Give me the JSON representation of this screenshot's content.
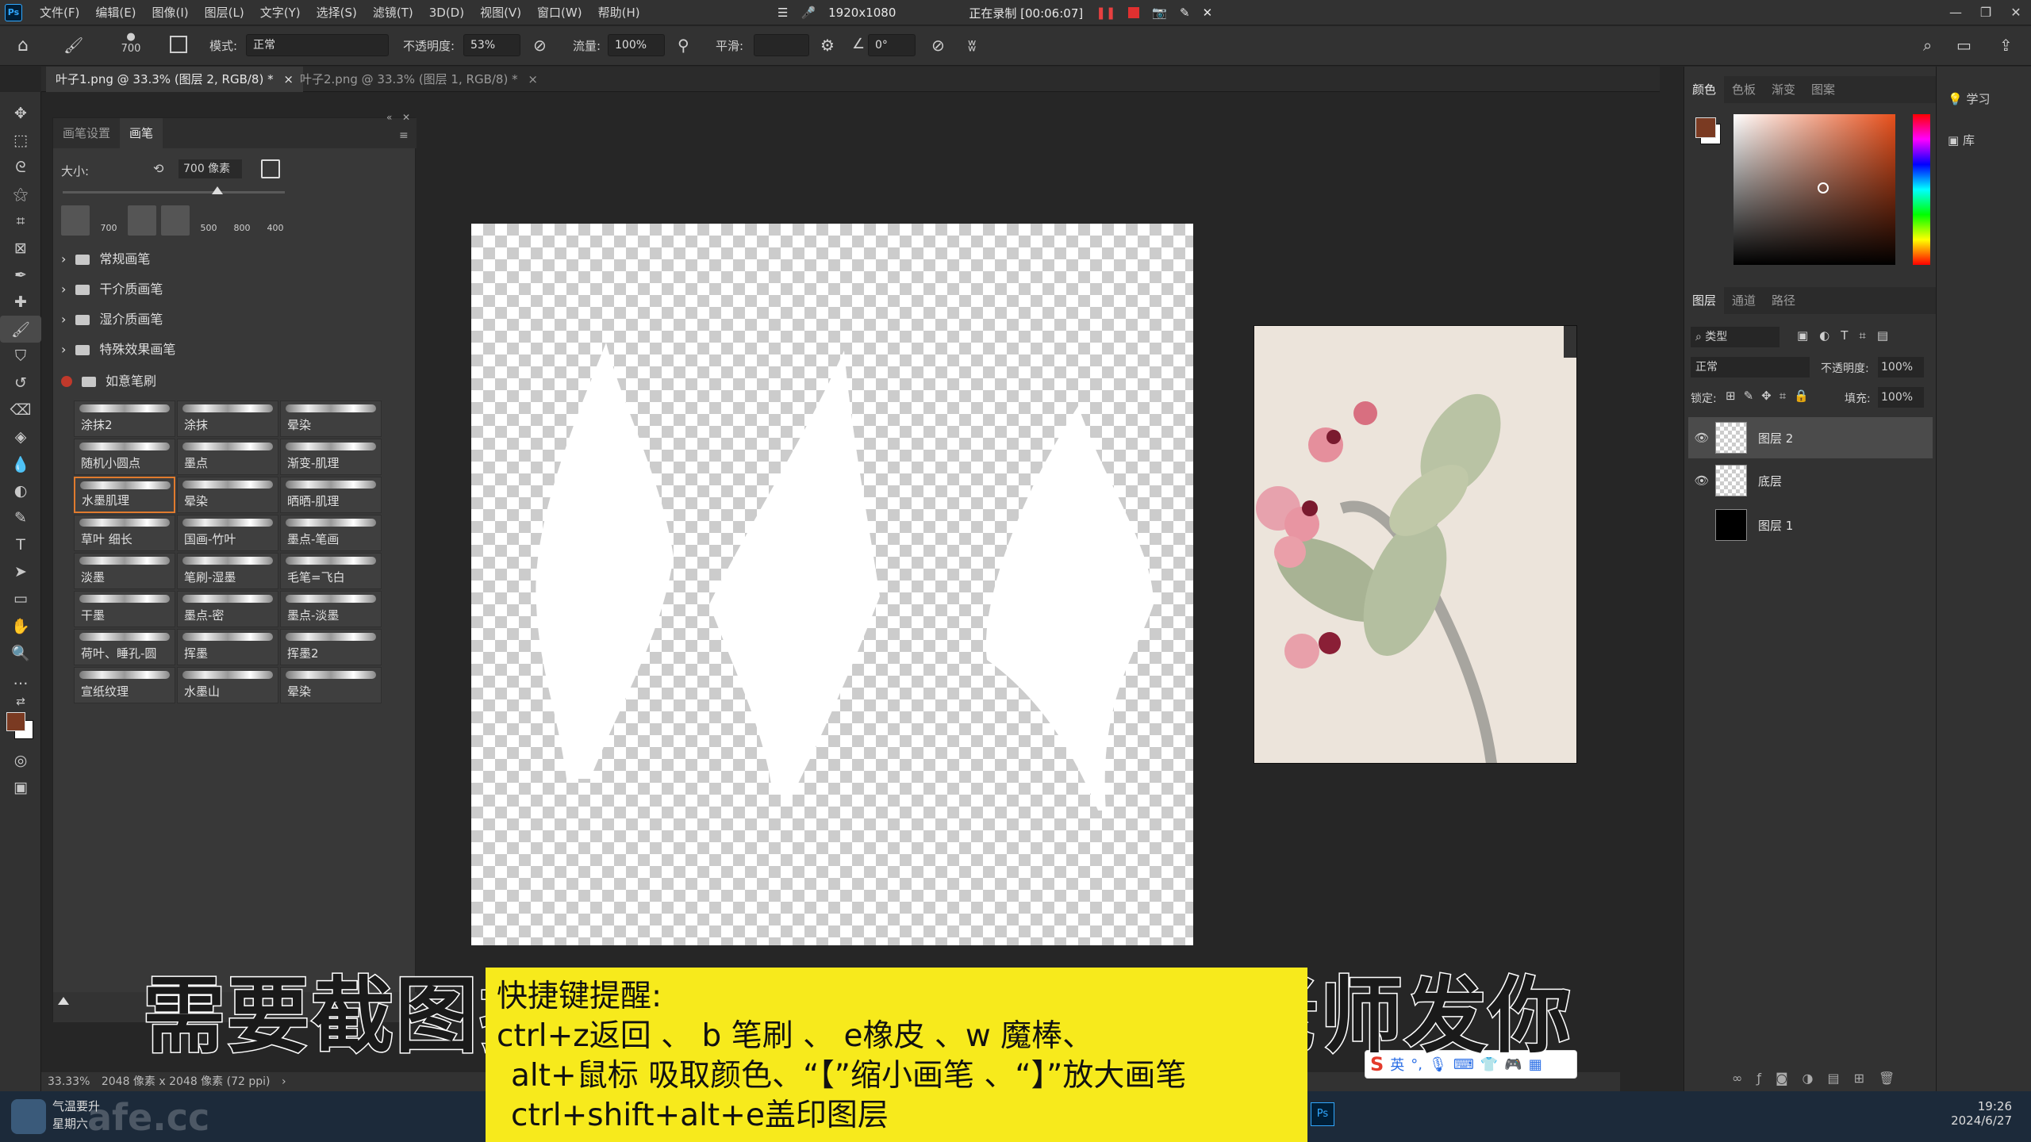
{
  "menubar": {
    "app_icon": "Ps",
    "items": [
      "文件(F)",
      "编辑(E)",
      "图像(I)",
      "图层(L)",
      "文字(Y)",
      "选择(S)",
      "滤镜(T)",
      "3D(D)",
      "视图(V)",
      "窗口(W)",
      "帮助(H)"
    ],
    "recorder": {
      "resolution": "1920x1080",
      "status": "正在录制 [00:06:07]"
    }
  },
  "options": {
    "brush_size": "700",
    "mode_label": "模式:",
    "mode_value": "正常",
    "opacity_label": "不透明度:",
    "opacity_value": "53%",
    "flow_label": "流量:",
    "flow_value": "100%",
    "smooth_label": "平滑:",
    "angle_value": "0°"
  },
  "tabs": [
    {
      "label": "叶子1.png @ 33.3% (图层 2, RGB/8) *"
    },
    {
      "label": "叶子2.png @ 33.3% (图层 1, RGB/8) *"
    }
  ],
  "brush_panel": {
    "tabs": [
      "画笔设置",
      "画笔"
    ],
    "size_label": "大小:",
    "size_value": "700 像素",
    "recent_sizes": [
      "700",
      "500",
      "800",
      "400"
    ],
    "folders": [
      "常规画笔",
      "干介质画笔",
      "湿介质画笔",
      "特殊效果画笔",
      "如意笔刷"
    ],
    "brushes": [
      [
        "涂抹2",
        "涂抹",
        "晕染"
      ],
      [
        "随机小圆点",
        "墨点",
        "渐变-肌理"
      ],
      [
        "水墨肌理",
        "晕染",
        "晒晒-肌理"
      ],
      [
        "草叶 细长",
        "国画-竹叶",
        "墨点-笔画"
      ],
      [
        "淡墨",
        "笔刷-湿墨",
        "毛笔=飞白"
      ],
      [
        "干墨",
        "墨点-密",
        "墨点-淡墨"
      ],
      [
        "荷叶、睡孔-圆",
        "挥墨",
        "挥墨2"
      ],
      [
        "宣纸纹理",
        "水墨山",
        "晕染"
      ]
    ]
  },
  "right_panel": {
    "color_tabs": [
      "颜色",
      "色板",
      "渐变",
      "图案"
    ],
    "foreground_color": "#7a3a22",
    "layers_tabs": [
      "图层",
      "通道",
      "路径"
    ],
    "filter_kind": "类型",
    "blend_mode": "正常",
    "opacity_label": "不透明度:",
    "opacity_value": "100%",
    "lock_label": "锁定:",
    "fill_label": "填充:",
    "fill_value": "100%",
    "layers": [
      {
        "name": "图层 2",
        "selected": true
      },
      {
        "name": "底层",
        "selected": false
      },
      {
        "name": "图层 1",
        "selected": false
      }
    ]
  },
  "learn_panel": {
    "items": [
      "学习",
      "库"
    ]
  },
  "status": {
    "zoom": "33.33%",
    "doc_info": "2048 像素 x 2048 像素 (72 ppi)"
  },
  "subtitle": "需要截图插件的可以在这私信老师发你",
  "tips": {
    "line1": "快捷键提醒:",
    "line2": "ctrl+z返回 、 b 笔刷 、 e橡皮 、w 魔棒、",
    "line3": "alt+鼠标 吸取颜色、“【”缩小画笔 、“】”放大画笔",
    "line4": "ctrl+shift+alt+e盖印图层"
  },
  "taskbar": {
    "weather": "气温要升",
    "day": "星期六",
    "watermark": "afe.cc",
    "time": "19:26",
    "date": "2024/6/27"
  },
  "ime": {
    "label": "英"
  }
}
